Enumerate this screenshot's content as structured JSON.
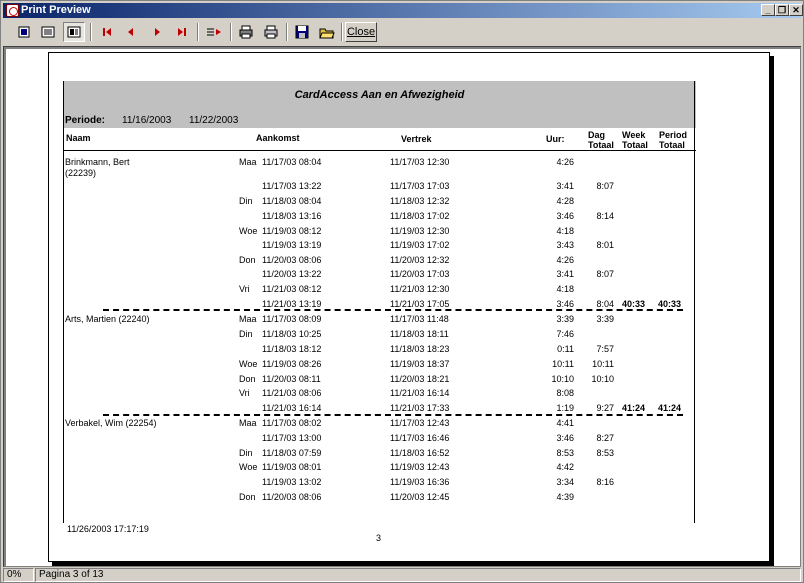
{
  "window": {
    "title": "Print Preview",
    "controls": [
      "_",
      "❐",
      "✕"
    ]
  },
  "toolbar": {
    "buttons": [
      "single-page-icon",
      "multi-page-icon",
      "zoom-icon",
      "first-page-icon",
      "prev-page-icon",
      "next-page-icon",
      "last-page-icon",
      "goto-page-icon",
      "print-setup-icon",
      "print-icon",
      "save-icon",
      "open-icon"
    ],
    "close_label": "Close"
  },
  "report": {
    "title": "CardAccess Aan en Afwezigheid",
    "periode_label": "Periode:",
    "periode_from": "11/16/2003",
    "periode_to": "11/22/2003",
    "columns": {
      "naam": "Naam",
      "aankomst": "Aankomst",
      "vertrek": "Vertrek",
      "uur": "Uur:",
      "dag": "Dag\nTotaal",
      "week": "Week\nTotaal",
      "period": "Period\nTotaal"
    },
    "rows": [
      {
        "name": "Brinkmann, Bert",
        "name2": "(22239)",
        "day": "Maa",
        "in": "11/17/03  08:04",
        "out": "11/17/03  12:30",
        "uur": "4:26",
        "dag": "",
        "week": "",
        "period": ""
      },
      {
        "name": "",
        "day": "",
        "in": "11/17/03  13:22",
        "out": "11/17/03  17:03",
        "uur": "3:41",
        "dag": "8:07",
        "week": "",
        "period": ""
      },
      {
        "name": "",
        "day": "Din",
        "in": "11/18/03  08:04",
        "out": "11/18/03  12:32",
        "uur": "4:28",
        "dag": "",
        "week": "",
        "period": ""
      },
      {
        "name": "",
        "day": "",
        "in": "11/18/03  13:16",
        "out": "11/18/03  17:02",
        "uur": "3:46",
        "dag": "8:14",
        "week": "",
        "period": ""
      },
      {
        "name": "",
        "day": "Woe",
        "in": "11/19/03  08:12",
        "out": "11/19/03  12:30",
        "uur": "4:18",
        "dag": "",
        "week": "",
        "period": ""
      },
      {
        "name": "",
        "day": "",
        "in": "11/19/03  13:19",
        "out": "11/19/03  17:02",
        "uur": "3:43",
        "dag": "8:01",
        "week": "",
        "period": ""
      },
      {
        "name": "",
        "day": "Don",
        "in": "11/20/03  08:06",
        "out": "11/20/03  12:32",
        "uur": "4:26",
        "dag": "",
        "week": "",
        "period": ""
      },
      {
        "name": "",
        "day": "",
        "in": "11/20/03  13:22",
        "out": "11/20/03  17:03",
        "uur": "3:41",
        "dag": "8:07",
        "week": "",
        "period": ""
      },
      {
        "name": "",
        "day": "Vri",
        "in": "11/21/03  08:12",
        "out": "11/21/03  12:30",
        "uur": "4:18",
        "dag": "",
        "week": "",
        "period": ""
      },
      {
        "name": "",
        "day": "",
        "in": "11/21/03  13:19",
        "out": "11/21/03  17:05",
        "uur": "3:46",
        "dag": "8:04",
        "week": "40:33",
        "period": "40:33"
      },
      {
        "name": "Arts, Martien (22240)",
        "day": "Maa",
        "in": "11/17/03  08:09",
        "out": "11/17/03  11:48",
        "uur": "3:39",
        "dag": "3:39",
        "week": "",
        "period": ""
      },
      {
        "name": "",
        "day": "Din",
        "in": "11/18/03  10:25",
        "out": "11/18/03  18:11",
        "uur": "7:46",
        "dag": "",
        "week": "",
        "period": ""
      },
      {
        "name": "",
        "day": "",
        "in": "11/18/03  18:12",
        "out": "11/18/03  18:23",
        "uur": "0:11",
        "dag": "7:57",
        "week": "",
        "period": ""
      },
      {
        "name": "",
        "day": "Woe",
        "in": "11/19/03  08:26",
        "out": "11/19/03  18:37",
        "uur": "10:11",
        "dag": "10:11",
        "week": "",
        "period": ""
      },
      {
        "name": "",
        "day": "Don",
        "in": "11/20/03  08:11",
        "out": "11/20/03  18:21",
        "uur": "10:10",
        "dag": "10:10",
        "week": "",
        "period": ""
      },
      {
        "name": "",
        "day": "Vri",
        "in": "11/21/03  08:06",
        "out": "11/21/03  16:14",
        "uur": "8:08",
        "dag": "",
        "week": "",
        "period": ""
      },
      {
        "name": "",
        "day": "",
        "in": "11/21/03  16:14",
        "out": "11/21/03  17:33",
        "uur": "1:19",
        "dag": "9:27",
        "week": "41:24",
        "period": "41:24"
      },
      {
        "name": "Verbakel, Wim (22254)",
        "day": "Maa",
        "in": "11/17/03  08:02",
        "out": "11/17/03  12:43",
        "uur": "4:41",
        "dag": "",
        "week": "",
        "period": ""
      },
      {
        "name": "",
        "day": "",
        "in": "11/17/03  13:00",
        "out": "11/17/03  16:46",
        "uur": "3:46",
        "dag": "8:27",
        "week": "",
        "period": ""
      },
      {
        "name": "",
        "day": "Din",
        "in": "11/18/03  07:59",
        "out": "11/18/03  16:52",
        "uur": "8:53",
        "dag": "8:53",
        "week": "",
        "period": ""
      },
      {
        "name": "",
        "day": "Woe",
        "in": "11/19/03  08:01",
        "out": "11/19/03  12:43",
        "uur": "4:42",
        "dag": "",
        "week": "",
        "period": ""
      },
      {
        "name": "",
        "day": "",
        "in": "11/19/03  13:02",
        "out": "11/19/03  16:36",
        "uur": "3:34",
        "dag": "8:16",
        "week": "",
        "period": ""
      },
      {
        "name": "",
        "day": "Don",
        "in": "11/20/03  08:06",
        "out": "11/20/03  12:45",
        "uur": "4:39",
        "dag": "",
        "week": "",
        "period": ""
      }
    ],
    "footer_date": "11/26/2003 17:17:19",
    "page_number": "3"
  },
  "status": {
    "zoom": "0%",
    "page": "Pagina 3 of 13"
  }
}
